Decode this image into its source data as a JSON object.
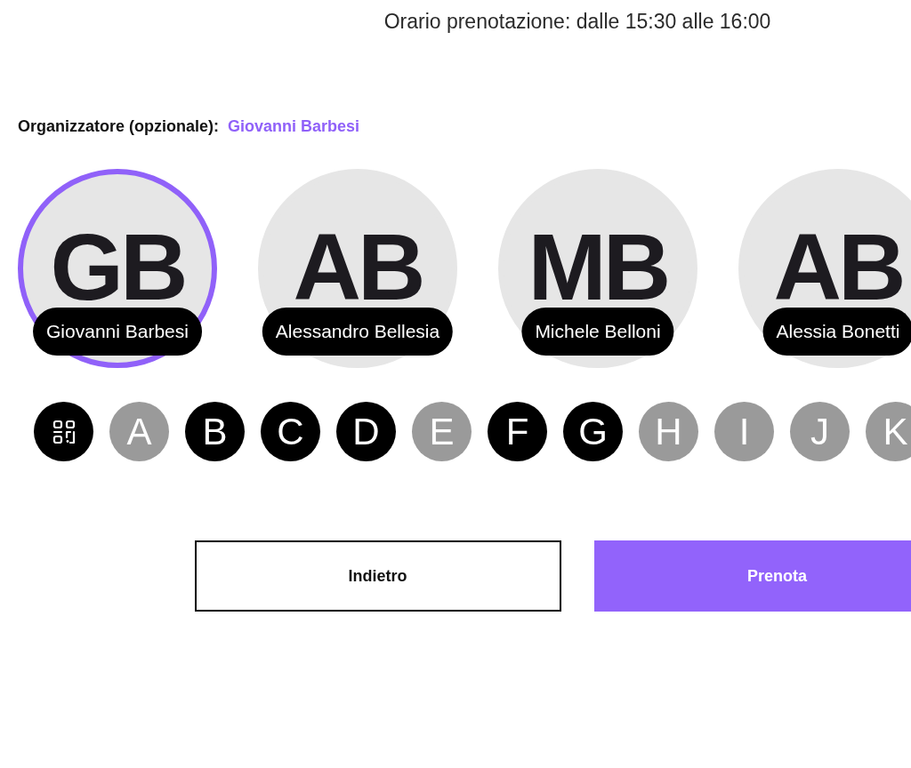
{
  "header": {
    "booking_time": "Orario prenotazione: dalle 15:30 alle 16:00"
  },
  "organizer": {
    "label": "Organizzatore (opzionale):",
    "value": "Giovanni Barbesi"
  },
  "people": [
    {
      "initials": "GB",
      "name": "Giovanni Barbesi",
      "selected": true
    },
    {
      "initials": "AB",
      "name": "Alessandro Bellesia",
      "selected": false
    },
    {
      "initials": "MB",
      "name": "Michele Belloni",
      "selected": false
    },
    {
      "initials": "AB",
      "name": "Alessia Bonetti",
      "selected": false
    }
  ],
  "letters": [
    {
      "letter": "A",
      "disabled": true
    },
    {
      "letter": "B",
      "disabled": false
    },
    {
      "letter": "C",
      "disabled": false
    },
    {
      "letter": "D",
      "disabled": false
    },
    {
      "letter": "E",
      "disabled": true
    },
    {
      "letter": "F",
      "disabled": false
    },
    {
      "letter": "G",
      "disabled": false
    },
    {
      "letter": "H",
      "disabled": true
    },
    {
      "letter": "I",
      "disabled": true
    },
    {
      "letter": "J",
      "disabled": true
    },
    {
      "letter": "K",
      "disabled": true
    }
  ],
  "buttons": [
    {
      "label": "Indietro",
      "kind": "secondary"
    },
    {
      "label": "Prenota",
      "kind": "primary"
    }
  ]
}
